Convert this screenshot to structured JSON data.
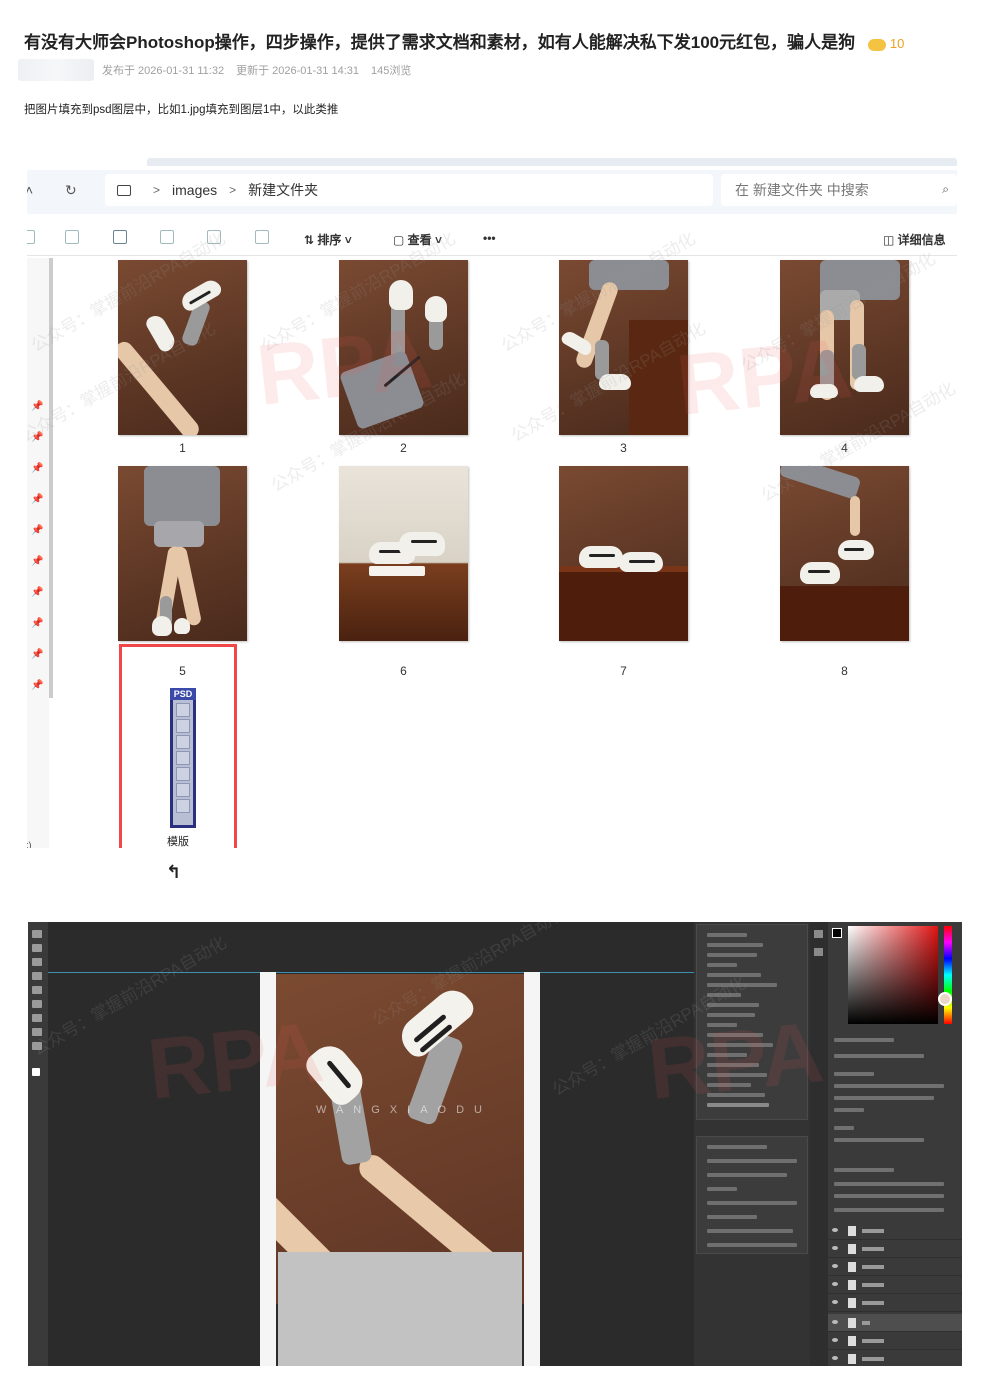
{
  "post": {
    "title": "有没有大师会Photoshop操作，四步操作，提供了需求文档和素材，如有人能解决私下发100元红包，骗人是狗",
    "reward": "10",
    "published": "发布于 2026-01-31 11:32",
    "updated": "更新于 2026-01-31 14:31",
    "views": "145浏览",
    "description": "把图片填充到psd图层中，比如1.jpg填充到图层1中，以此类推"
  },
  "explorer": {
    "breadcrumb": [
      "images",
      "新建文件夹"
    ],
    "search_placeholder": "在 新建文件夹 中搜索",
    "toolbar": {
      "sort_label": "排序",
      "view_label": "查看",
      "more_label": "•••",
      "details_label": "详细信息"
    },
    "files": [
      {
        "name": "1",
        "kind": "jpg"
      },
      {
        "name": "2",
        "kind": "jpg"
      },
      {
        "name": "3",
        "kind": "jpg"
      },
      {
        "name": "4",
        "kind": "jpg"
      },
      {
        "name": "5",
        "kind": "jpg"
      },
      {
        "name": "6",
        "kind": "jpg"
      },
      {
        "name": "7",
        "kind": "jpg"
      },
      {
        "name": "8",
        "kind": "jpg"
      },
      {
        "name": "模版",
        "kind": "psd"
      }
    ],
    "psd_badge": "PSD",
    "highlight_color": "#f04848"
  },
  "watermarks": {
    "text": "公众号：掌握前沿RPA自动化",
    "big": "RPA"
  },
  "photoshop": {
    "photo_brand": "WANGXIAODU"
  },
  "colors": {
    "ps_bg": "#2b2b2b",
    "guide": "#3f8fb0",
    "coin": "#f0a020"
  }
}
